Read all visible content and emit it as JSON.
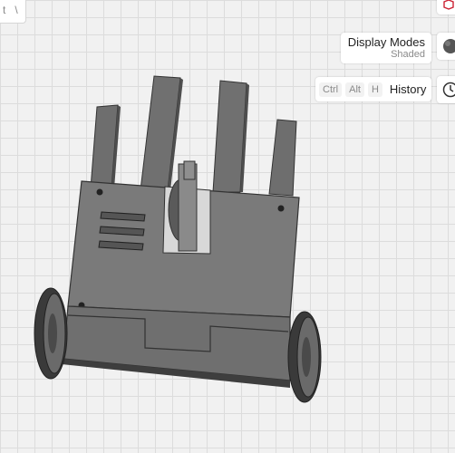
{
  "toolbar": {
    "key1": "t",
    "key2": "\\"
  },
  "display_modes": {
    "title": "Display Modes",
    "value": "Shaded"
  },
  "history": {
    "shortcut_ctrl": "Ctrl",
    "shortcut_alt": "Alt",
    "shortcut_key": "H",
    "label": "History"
  },
  "icons": {
    "top_right": "cube-view-icon",
    "display": "sphere-icon",
    "history": "clock-icon"
  },
  "colors": {
    "model_face": "#777777",
    "model_dark": "#4a4a4a",
    "grid": "#dcdcdc",
    "background": "#f1f1f1"
  }
}
